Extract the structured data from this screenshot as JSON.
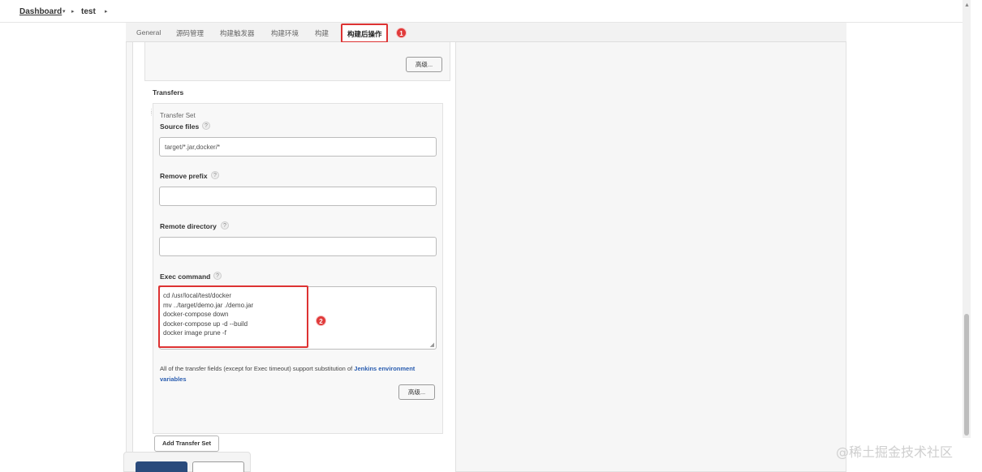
{
  "breadcrumb": {
    "dashboard": "Dashboard",
    "job": "test"
  },
  "tabs": [
    {
      "label": "General"
    },
    {
      "label": "源码管理"
    },
    {
      "label": "构建触发器"
    },
    {
      "label": "构建环境"
    },
    {
      "label": "构建"
    },
    {
      "label": "构建后操作",
      "active": true
    }
  ],
  "annotations": {
    "tab_marker": "1",
    "exec_marker": "2",
    "highlight_color": "#dd3333"
  },
  "advanced_button": "高级...",
  "transfers": {
    "title": "Transfers",
    "set_label": "Transfer Set",
    "source_files": {
      "label": "Source files",
      "value": "target/*.jar,docker/*"
    },
    "remove_prefix": {
      "label": "Remove prefix",
      "value": ""
    },
    "remote_directory": {
      "label": "Remote directory",
      "value": ""
    },
    "exec_command": {
      "label": "Exec command",
      "lines": [
        "cd /usr/local/test/docker",
        "mv ../target/demo.jar ./demo.jar",
        "docker-compose down",
        "docker-compose up -d --build",
        "docker image prune -f"
      ]
    },
    "help": "?",
    "info_text": "All of the transfer fields (except for Exec timeout) support substitution of ",
    "info_link": "Jenkins environment variables",
    "advanced_button": "高级...",
    "add_button": "Add Transfer Set"
  },
  "watermark": "@稀土掘金技术社区"
}
